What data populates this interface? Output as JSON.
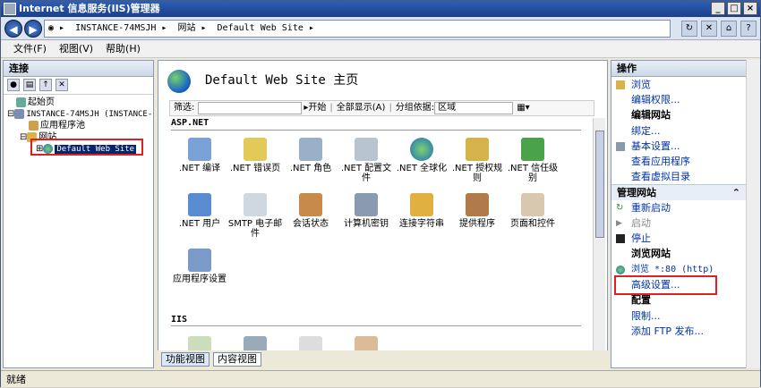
{
  "window": {
    "title": "Internet 信息服务(IIS)管理器"
  },
  "address": {
    "crumbs": [
      "INSTANCE-74MSJH",
      "网站",
      "Default Web Site"
    ]
  },
  "menu": [
    "文件(F)",
    "视图(V)",
    "帮助(H)"
  ],
  "left": {
    "header": "连接",
    "tree": [
      "起始页",
      "INSTANCE-74MSJH (INSTANCE-",
      "应用程序池",
      "网站",
      "Default Web Site"
    ]
  },
  "center": {
    "title": "Default Web Site 主页",
    "filter_label": "筛选:",
    "start_label": "开始",
    "showall_label": "全部显示(A)",
    "group_label": "分组依据:",
    "group_value": "区域",
    "section1": "ASP.NET",
    "tiles1": [
      ".NET 编译",
      ".NET 错误页",
      ".NET 角色",
      ".NET 配置文件",
      ".NET 全球化",
      ".NET 授权规则",
      ".NET 信任级别",
      ".NET 用户",
      "SMTP 电子邮件",
      "会话状态",
      "计算机密钥",
      "连接字符串",
      "提供程序",
      "页面和控件",
      "应用程序设置"
    ],
    "section2": "IIS",
    "views": [
      "功能视图",
      "内容视图"
    ]
  },
  "right": {
    "header": "操作",
    "actions_top": [
      "浏览",
      "编辑权限..."
    ],
    "edit_site": "编辑网站",
    "edit_actions": [
      "绑定...",
      "基本设置...",
      "查看应用程序",
      "查看虚拟目录"
    ],
    "manage_header": "管理网站",
    "manage_actions": [
      "重新启动",
      "启动",
      "停止"
    ],
    "browse_header": "浏览网站",
    "browse_actions": [
      "浏览 *:80 (http)"
    ],
    "adv": "高级设置...",
    "config_header": "配置",
    "config_actions": [
      "限制...",
      "添加 FTP 发布..."
    ]
  },
  "status": "就绪",
  "colors": {
    "title_bar": "#1b3f8c",
    "highlight": "#0a246a",
    "red_box": "#e02020",
    "link": "#0033aa"
  }
}
